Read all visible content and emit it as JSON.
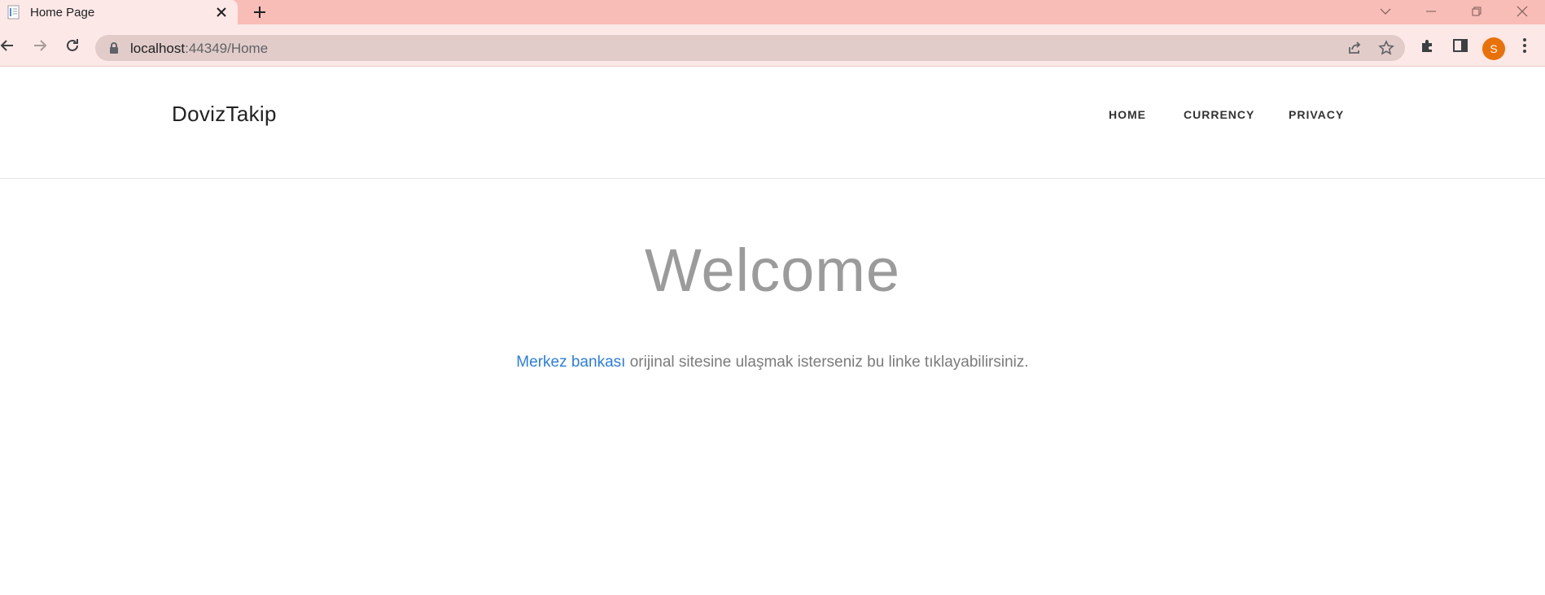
{
  "browser": {
    "tab_title": "Home Page",
    "url_host": "localhost",
    "url_path": ":44349/Home",
    "avatar_letter": "S",
    "colors": {
      "tabstrip": "#f8bdb6",
      "toolbar": "#fce8e6",
      "avatar": "#e8710a"
    }
  },
  "site": {
    "brand": "DovizTakip",
    "nav": [
      {
        "label": "HOME"
      },
      {
        "label": "CURRENCY"
      },
      {
        "label": "PRIVACY"
      }
    ]
  },
  "main": {
    "title": "Welcome",
    "link_text": "Merkez bankası",
    "intro_text": " orijinal sitesine ulaşmak isterseniz bu linke tıklayabilirsiniz.",
    "colors": {
      "title": "#9b9b9b",
      "link": "#2b7de0"
    }
  }
}
